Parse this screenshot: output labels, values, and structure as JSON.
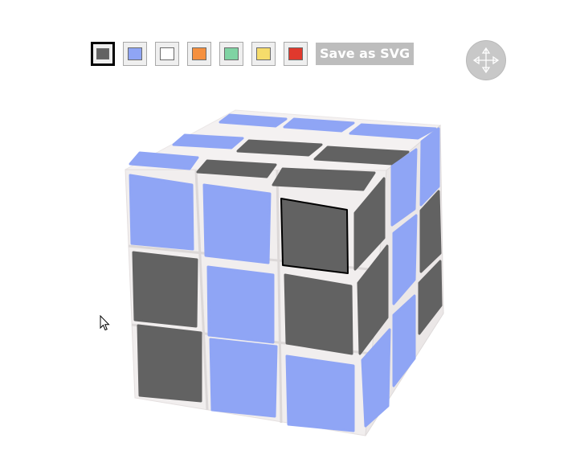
{
  "toolbar": {
    "swatches": [
      {
        "name": "dark-gray",
        "color": "#626262",
        "selected": true
      },
      {
        "name": "blue",
        "color": "#8fa5f5",
        "selected": false
      },
      {
        "name": "white",
        "color": "#ffffff",
        "selected": false
      },
      {
        "name": "orange",
        "color": "#f5903f",
        "selected": false
      },
      {
        "name": "green",
        "color": "#7fd3a3",
        "selected": false
      },
      {
        "name": "yellow",
        "color": "#f6dc6b",
        "selected": false
      },
      {
        "name": "red",
        "color": "#e0392d",
        "selected": false
      }
    ],
    "save_label": "Save as SVG"
  },
  "move_handle": {
    "icon": "move-arrows-icon"
  },
  "cube": {
    "body_color": "#f1eeee",
    "selected_sticker": "front-row1-col3",
    "faces": {
      "top": [
        [
          "blue",
          "blue",
          "blue"
        ],
        [
          "blue",
          "dark-gray",
          "dark-gray"
        ],
        [
          "blue",
          "dark-gray",
          "dark-gray"
        ]
      ],
      "front": [
        [
          "blue",
          "blue",
          "dark-gray"
        ],
        [
          "dark-gray",
          "blue",
          "dark-gray"
        ],
        [
          "dark-gray",
          "blue",
          "blue"
        ]
      ],
      "right": [
        [
          "dark-gray",
          "blue",
          "blue"
        ],
        [
          "dark-gray",
          "blue",
          "dark-gray"
        ],
        [
          "blue",
          "blue",
          "dark-gray"
        ]
      ]
    }
  }
}
